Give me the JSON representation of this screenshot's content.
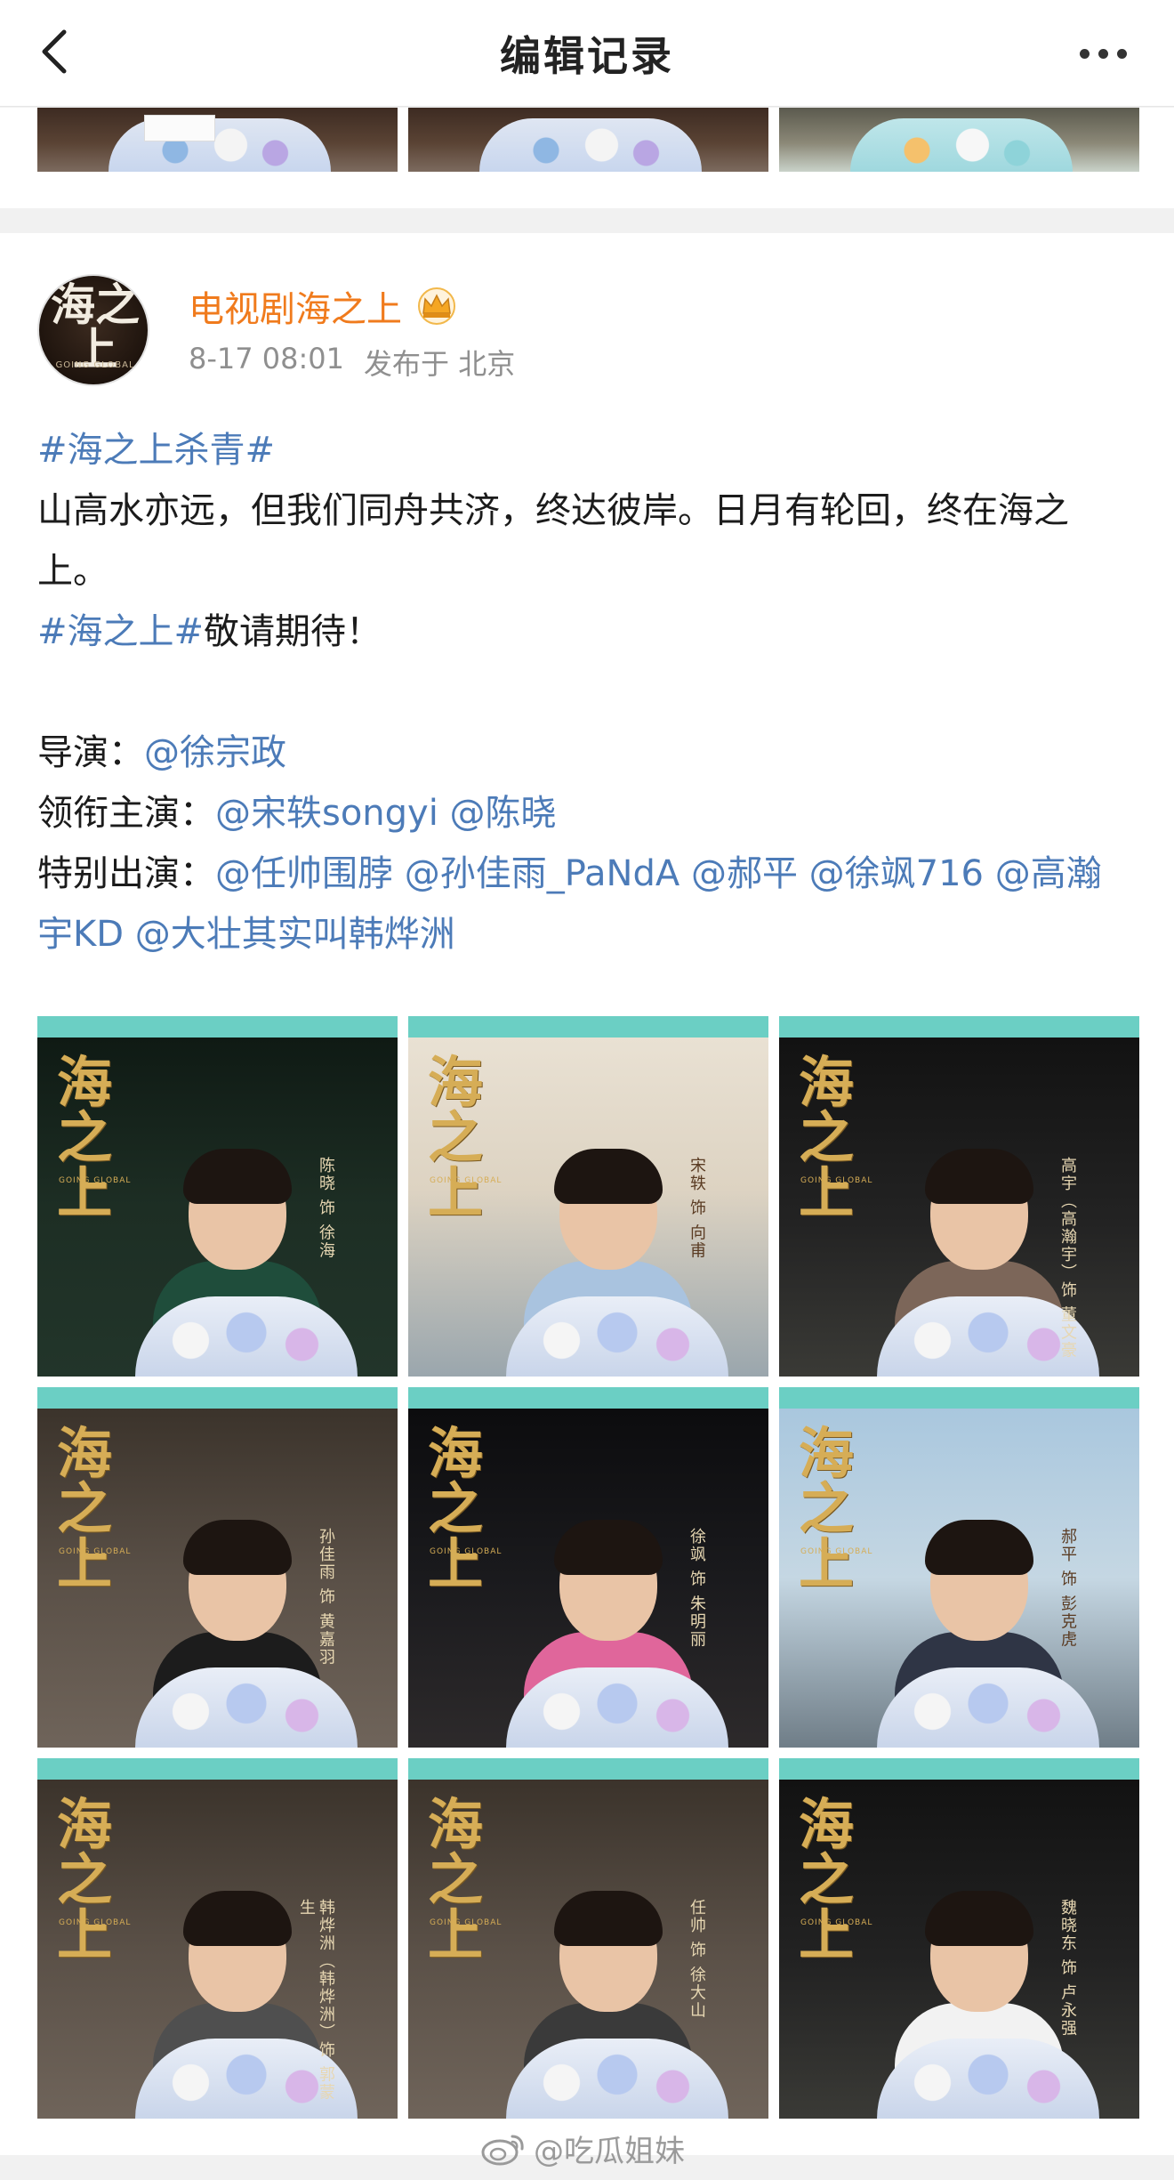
{
  "nav": {
    "title": "编辑记录"
  },
  "post": {
    "author": "电视剧海之上",
    "avatar_text": "海之上",
    "avatar_sub": "GOING GLOBAL",
    "timestamp": "8-17 08:01",
    "location": "发布于 北京",
    "lines": [
      {
        "parts": [
          {
            "text": "#海之上杀青#",
            "link": true
          }
        ]
      },
      {
        "parts": [
          {
            "text": "山高水亦远，但我们同舟共济，终达彼岸。日月有轮回，终在海之上。",
            "link": false
          }
        ]
      },
      {
        "parts": [
          {
            "text": "#海之上#",
            "link": true
          },
          {
            "text": "敬请期待！",
            "link": false
          }
        ]
      },
      {
        "parts": []
      },
      {
        "parts": [
          {
            "text": "导演：",
            "link": false
          },
          {
            "text": "@徐宗政",
            "link": true
          }
        ]
      },
      {
        "parts": [
          {
            "text": "领衔主演：",
            "link": false
          },
          {
            "text": "@宋轶songyi @陈晓",
            "link": true
          }
        ]
      },
      {
        "parts": [
          {
            "text": "特别出演：",
            "link": false
          },
          {
            "text": "@任帅围脖 @孙佳雨_PaNdA @郝平 @徐飒716 @高瀚宇KD @大壮其实叫韩烨洲",
            "link": true
          }
        ]
      }
    ]
  },
  "images": [
    {
      "logo": "海之上",
      "logo_sub": "GOING GLOBAL",
      "caption": "陈晓 饰 徐海",
      "theme": "dark-green"
    },
    {
      "logo": "海之上",
      "logo_sub": "GOING GLOBAL",
      "caption": "宋轶 饰 向甫",
      "theme": "light"
    },
    {
      "logo": "海之上",
      "logo_sub": "GOING GLOBAL",
      "caption": "高宇（高瀚宇）饰 董文豪",
      "theme": "dark"
    },
    {
      "logo": "海之上",
      "logo_sub": "GOING GLOBAL",
      "caption": "孙佳雨 饰 黄嘉羽",
      "theme": "stone"
    },
    {
      "logo": "海之上",
      "logo_sub": "GOING GLOBAL",
      "caption": "徐飒 饰 朱明丽",
      "theme": "night"
    },
    {
      "logo": "海之上",
      "logo_sub": "GOING GLOBAL",
      "caption": "郝平 饰 彭克虎",
      "theme": "sky"
    },
    {
      "logo": "海之上",
      "logo_sub": "GOING GLOBAL",
      "caption": "韩烨洲（韩烨洲）饰 郭蒙生",
      "theme": "stone"
    },
    {
      "logo": "海之上",
      "logo_sub": "GOING GLOBAL",
      "caption": "任帅 饰 徐大山",
      "theme": "stone"
    },
    {
      "logo": "海之上",
      "logo_sub": "GOING GLOBAL",
      "caption": "魏晓东 饰 卢永强",
      "theme": "dark"
    }
  ],
  "watermark": "@吃瓜姐妹",
  "colors": {
    "accent_link": "#4c7bb8",
    "author_name": "#f07b1d",
    "teal_band": "#6bcfc4",
    "logo_gold": "#d6ad56"
  }
}
